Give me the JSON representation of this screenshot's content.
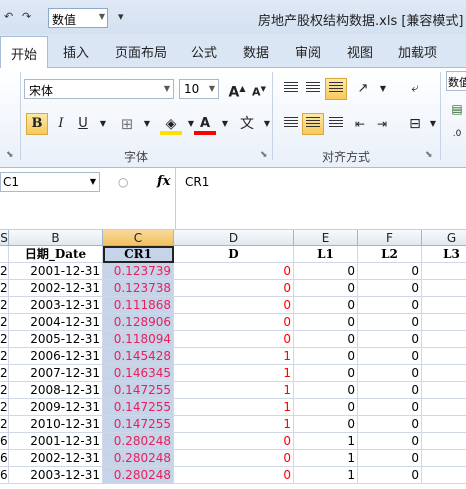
{
  "window": {
    "quick_access_undo": "↶",
    "quick_access_redo": "↷",
    "quick_access_combo": "数值",
    "quick_access_more": "▾",
    "title": "房地产股权结构数据.xls  [兼容模式]"
  },
  "ribbon_tabs": [
    {
      "label": "开始"
    },
    {
      "label": "插入"
    },
    {
      "label": "页面布局"
    },
    {
      "label": "公式"
    },
    {
      "label": "数据"
    },
    {
      "label": "审阅"
    },
    {
      "label": "视图"
    },
    {
      "label": "加载项"
    }
  ],
  "ribbon": {
    "font_name": "宋体",
    "font_size": "10",
    "grow_font": "A",
    "shrink_font": "A",
    "bold": "B",
    "italic": "I",
    "underline": "U",
    "font_color_letter": "A",
    "wen_button": "文",
    "font_group_label": "字体",
    "align_group_label": "对齐方式",
    "number_format_partial": "数值",
    "accent_yellow": "#f7c95a",
    "font_color": "#ff0000"
  },
  "formula_bar": {
    "name_box": "C1",
    "fx_label": "fx",
    "formula": "CR1"
  },
  "sheet": {
    "columns": [
      "S",
      "B",
      "C",
      "D",
      "E",
      "F",
      "G"
    ],
    "header_row": [
      "",
      "日期_Date",
      "CR1",
      "D",
      "L1",
      "L2",
      "L3"
    ],
    "rows": [
      [
        "2",
        "2001-12-31",
        "0.123739",
        "0",
        "0",
        "0"
      ],
      [
        "2",
        "2002-12-31",
        "0.123738",
        "0",
        "0",
        "0"
      ],
      [
        "2",
        "2003-12-31",
        "0.111868",
        "0",
        "0",
        "0"
      ],
      [
        "2",
        "2004-12-31",
        "0.128906",
        "0",
        "0",
        "0"
      ],
      [
        "2",
        "2005-12-31",
        "0.118094",
        "0",
        "0",
        "0"
      ],
      [
        "2",
        "2006-12-31",
        "0.145428",
        "1",
        "0",
        "0"
      ],
      [
        "2",
        "2007-12-31",
        "0.146345",
        "1",
        "0",
        "0"
      ],
      [
        "2",
        "2008-12-31",
        "0.147255",
        "1",
        "0",
        "0"
      ],
      [
        "2",
        "2009-12-31",
        "0.147255",
        "1",
        "0",
        "0"
      ],
      [
        "2",
        "2010-12-31",
        "0.147255",
        "1",
        "0",
        "0"
      ],
      [
        "6",
        "2001-12-31",
        "0.280248",
        "0",
        "1",
        "0"
      ],
      [
        "6",
        "2002-12-31",
        "0.280248",
        "0",
        "1",
        "0"
      ],
      [
        "6",
        "2003-12-31",
        "0.280248",
        "0",
        "1",
        "0"
      ]
    ]
  }
}
